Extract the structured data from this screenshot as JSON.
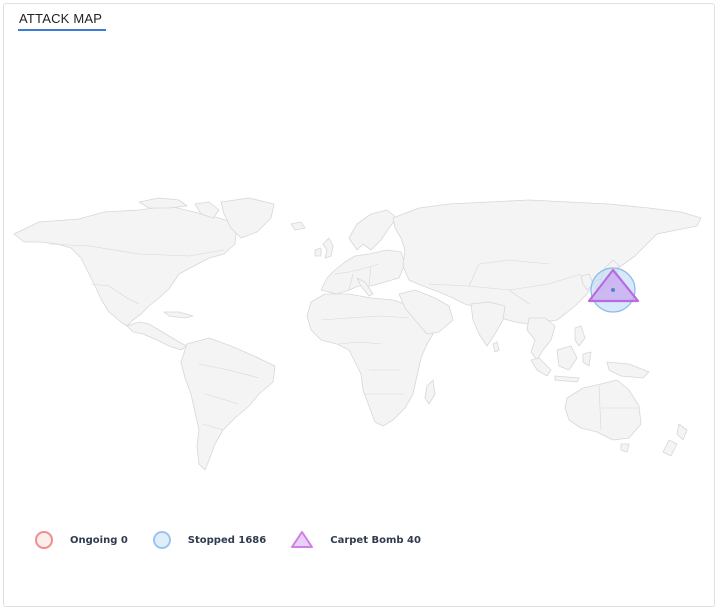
{
  "widget": {
    "title": "ATTACK MAP"
  },
  "legend": [
    {
      "key": "ongoing",
      "label": "Ongoing 0",
      "shape": "circle",
      "stroke": "#f28b8b",
      "fill": "#fdeeee"
    },
    {
      "key": "stopped",
      "label": "Stopped 1686",
      "shape": "circle",
      "stroke": "#9cc4ee",
      "fill": "#dfeefb"
    },
    {
      "key": "carpet_bomb",
      "label": "Carpet Bomb 40",
      "shape": "triangle",
      "stroke": "#cf7fe8",
      "fill": "#ead0f6"
    }
  ],
  "map": {
    "land_fill": "#f4f4f5",
    "border_stroke": "#d7d7da",
    "markers": [
      {
        "type": "stopped",
        "location": "Japan",
        "shape": "circle",
        "fill": "#bcd9f7",
        "stroke": "#8fbbe9"
      },
      {
        "type": "carpet_bomb",
        "location": "Japan",
        "shape": "triangle",
        "fill": "#c8a0ee",
        "stroke": "#b86be0"
      }
    ]
  }
}
